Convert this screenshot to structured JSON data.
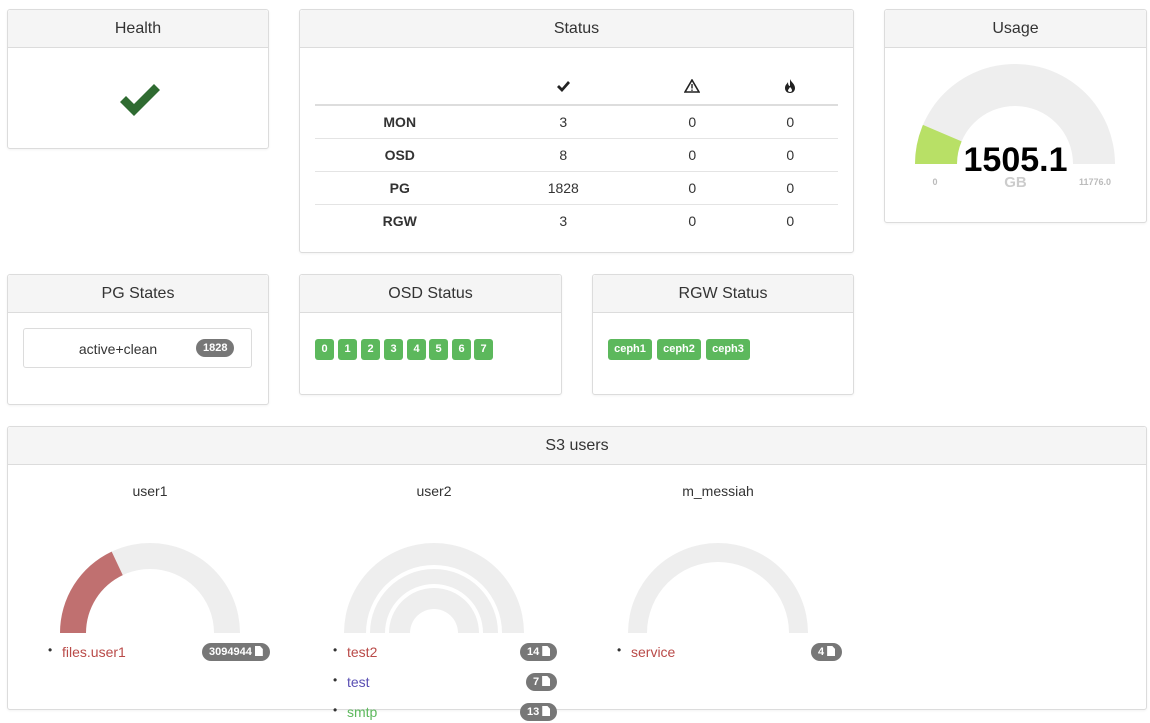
{
  "health": {
    "title": "Health",
    "state_icon": "check-icon"
  },
  "status": {
    "title": "Status",
    "columns": [
      {
        "icon": "check-icon",
        "glyph": "✔"
      },
      {
        "icon": "warning-icon",
        "glyph": "⚠"
      },
      {
        "icon": "fire-icon",
        "glyph": "🔥"
      }
    ],
    "rows": [
      {
        "label": "MON",
        "ok": "3",
        "warn": "0",
        "err": "0"
      },
      {
        "label": "OSD",
        "ok": "8",
        "warn": "0",
        "err": "0"
      },
      {
        "label": "PG",
        "ok": "1828",
        "warn": "0",
        "err": "0"
      },
      {
        "label": "RGW",
        "ok": "3",
        "warn": "0",
        "err": "0"
      }
    ]
  },
  "usage": {
    "title": "Usage",
    "value": "1505.1",
    "unit": "GB",
    "min": "0",
    "max": "11776.0",
    "used": 1505.1,
    "total": 11776.0,
    "gauge_color": "#b8e066"
  },
  "pg_states": {
    "title": "PG States",
    "items": [
      {
        "label": "active+clean",
        "count": "1828"
      }
    ]
  },
  "osd_status": {
    "title": "OSD Status",
    "osds": [
      "0",
      "1",
      "2",
      "3",
      "4",
      "5",
      "6",
      "7"
    ],
    "color": "#5cb85c"
  },
  "rgw_status": {
    "title": "RGW Status",
    "gateways": [
      "ceph1",
      "ceph2",
      "ceph3"
    ],
    "color": "#5cb85c"
  },
  "s3_users": {
    "title": "S3 users",
    "users": [
      {
        "name": "user1",
        "buckets": [
          {
            "name": "files.user1",
            "count": "3094944",
            "color": "#b94a48",
            "fraction": 0.36
          }
        ]
      },
      {
        "name": "user2",
        "buckets": [
          {
            "name": "test2",
            "count": "14",
            "color": "#b94a48",
            "fraction": 0.0
          },
          {
            "name": "test",
            "count": "7",
            "color": "#5a4fb3",
            "fraction": 0.0
          },
          {
            "name": "smtp",
            "count": "13",
            "color": "#5cb85c",
            "fraction": 0.0
          }
        ]
      },
      {
        "name": "m_messiah",
        "buckets": [
          {
            "name": "service",
            "count": "4",
            "color": "#b94a48",
            "fraction": 0.0
          }
        ]
      }
    ]
  }
}
